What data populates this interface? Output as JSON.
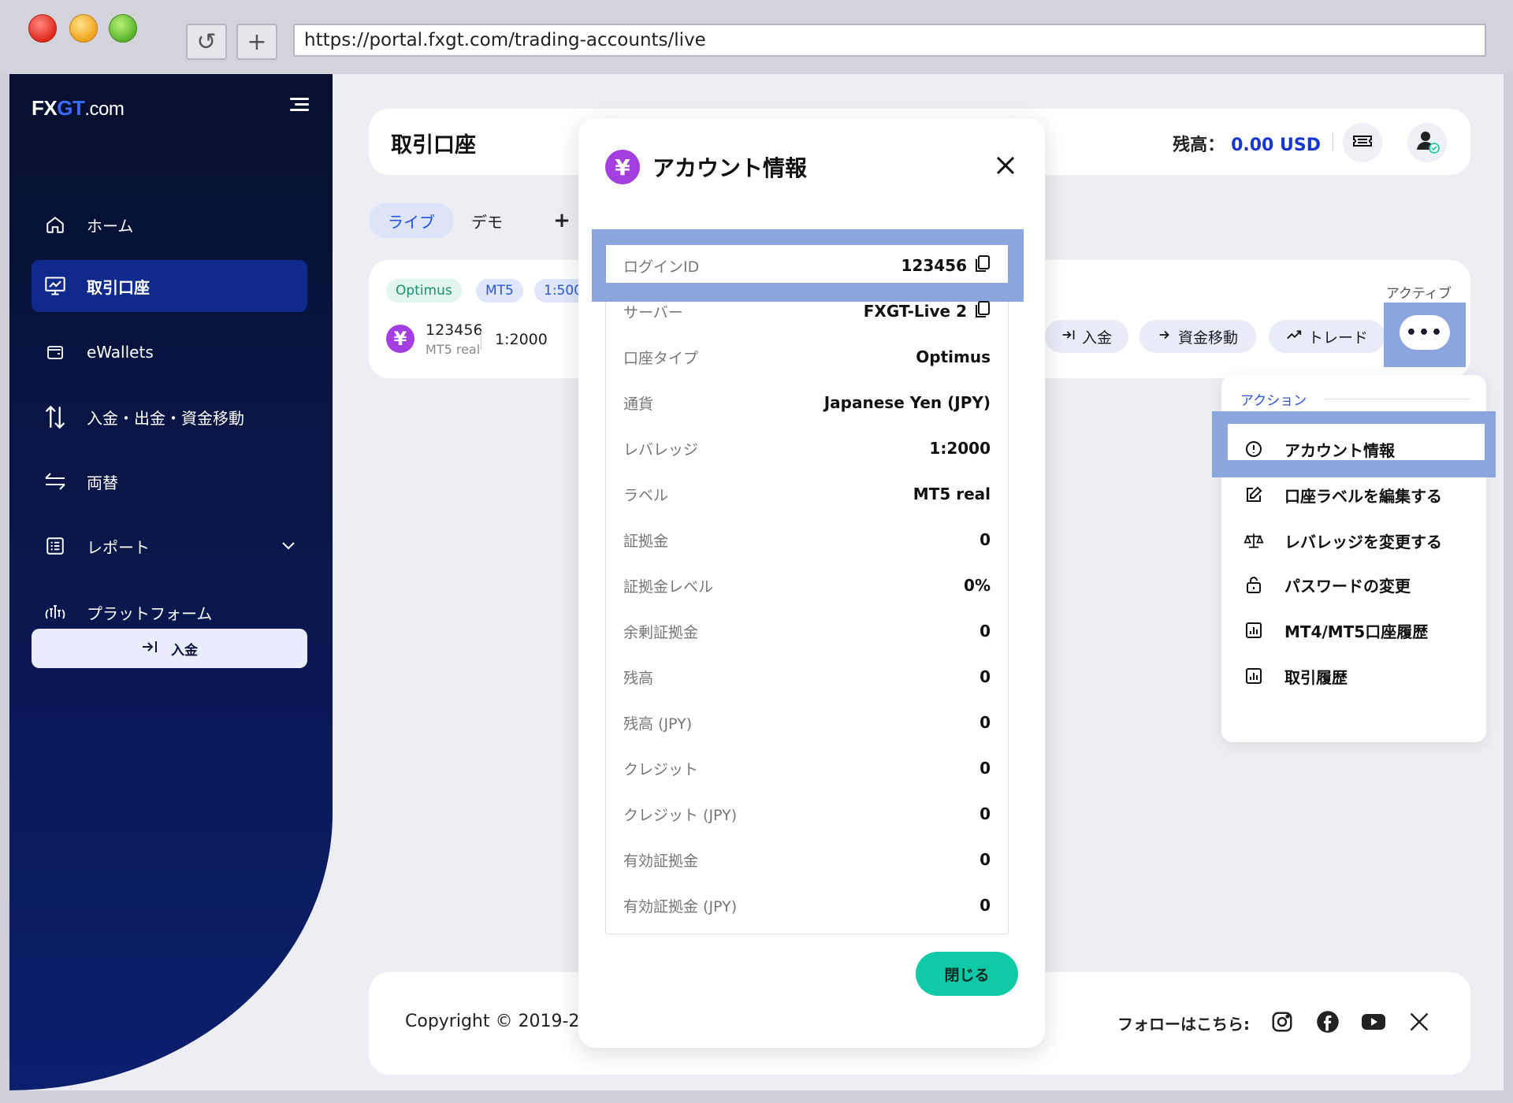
{
  "browser": {
    "url": "https://portal.fxgt.com/trading-accounts/live",
    "reload_label": "↺",
    "new_tab_label": "+"
  },
  "sidebar": {
    "logo": {
      "fx": "FX",
      "g": "GT",
      "suffix": ".com"
    },
    "items": [
      {
        "label": "ホーム"
      },
      {
        "label": "取引口座"
      },
      {
        "label": "eWallets"
      },
      {
        "label": "入金・出金・資金移動"
      },
      {
        "label": "両替"
      },
      {
        "label": "レポート"
      },
      {
        "label": "プラットフォーム"
      }
    ],
    "deposit_label": "入金"
  },
  "header": {
    "title": "取引口座",
    "balance_label": "残高：",
    "balance_value": "0.00 USD"
  },
  "tabs": {
    "live": "ライブ",
    "demo": "デモ",
    "add": "+"
  },
  "account": {
    "chips": [
      "Optimus",
      "MT5",
      "1:500"
    ],
    "number": "123456",
    "sub": "MT5 real",
    "leverage": "1:2000",
    "status": "アクティブ",
    "actions": [
      "入金",
      "資金移動",
      "トレード"
    ],
    "more": "•••"
  },
  "dropdown": {
    "title": "アクション",
    "items": [
      {
        "label": "アカウント情報",
        "icon": "info-icon"
      },
      {
        "label": "口座ラベルを編集する",
        "icon": "edit-icon"
      },
      {
        "label": "レバレッジを変更する",
        "icon": "scale-icon"
      },
      {
        "label": "パスワードの変更",
        "icon": "lock-icon"
      },
      {
        "label": "MT4/MT5口座履歴",
        "icon": "chart-icon"
      },
      {
        "label": "取引履歴",
        "icon": "chart-icon"
      }
    ]
  },
  "footer": {
    "copyright": "Copyright © 2019-2",
    "follow": "フォローはこちら:"
  },
  "modal": {
    "title": "アカウント情報",
    "yen": "¥",
    "rows": [
      {
        "label": "ログインID",
        "value": "123456"
      },
      {
        "label": "サーバー",
        "value": "FXGT-Live 2"
      },
      {
        "label": "口座タイプ",
        "value": "Optimus"
      },
      {
        "label": "通貨",
        "value": "Japanese Yen (JPY)"
      },
      {
        "label": "レバレッジ",
        "value": "1:2000"
      },
      {
        "label": "ラベル",
        "value": "MT5 real"
      },
      {
        "label": "証拠金",
        "value": "0"
      },
      {
        "label": "証拠金レベル",
        "value": "0%"
      },
      {
        "label": "余剰証拠金",
        "value": "0"
      },
      {
        "label": "残高",
        "value": "0"
      },
      {
        "label": "残高 (JPY)",
        "value": "0"
      },
      {
        "label": "クレジット",
        "value": "0"
      },
      {
        "label": "クレジット (JPY)",
        "value": "0"
      },
      {
        "label": "有効証拠金",
        "value": "0"
      },
      {
        "label": "有効証拠金 (JPY)",
        "value": "0"
      }
    ],
    "close_label": "閉じる"
  },
  "colors": {
    "accent": "#1636d0",
    "sidebar": "#0a1850",
    "highlight": "#8aa6dc",
    "teal": "#10c9a6",
    "yen": "#a43ee0"
  }
}
